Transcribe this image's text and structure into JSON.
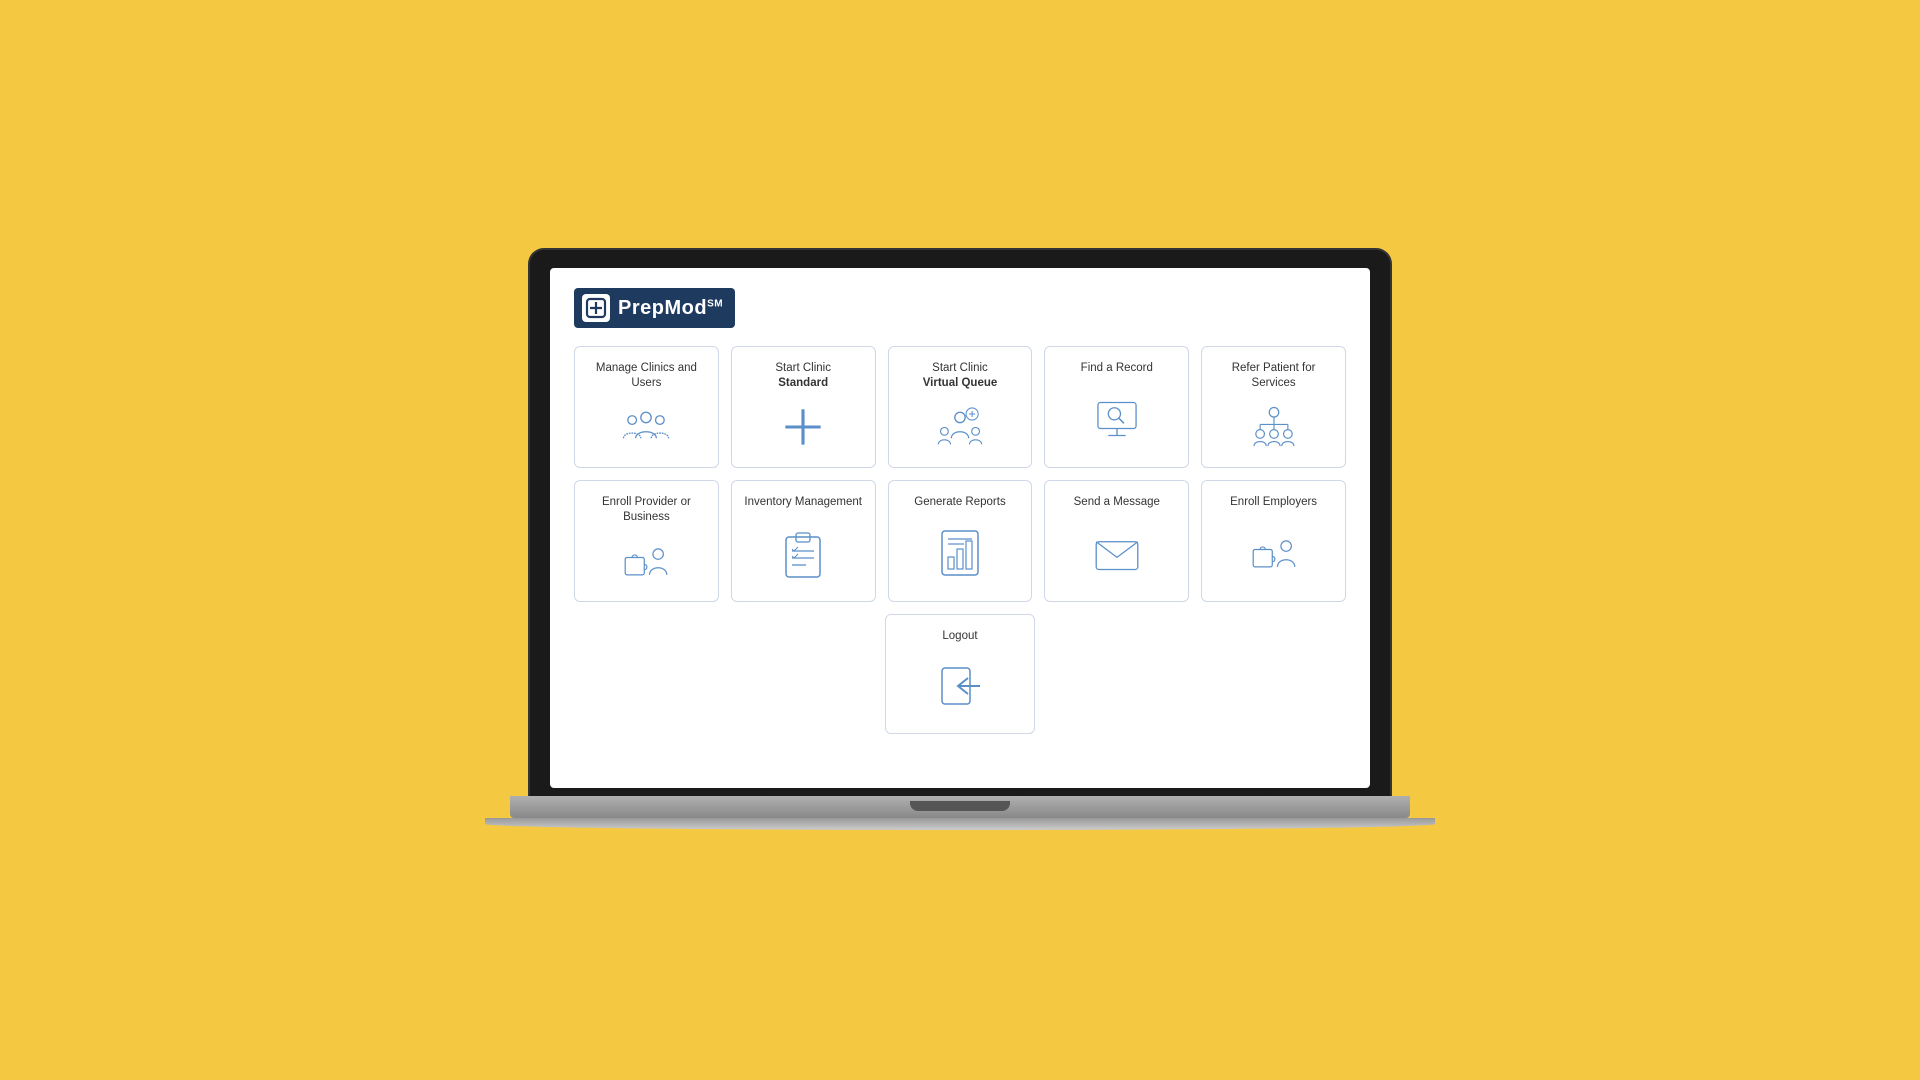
{
  "logo": {
    "brand": "PrepMod",
    "sm_text": "SM",
    "icon_symbol": "✚"
  },
  "cards": [
    {
      "id": "manage-clinics",
      "title": "Manage Clinics and Users",
      "title_bold": null,
      "icon": "manage-clinics-icon"
    },
    {
      "id": "start-clinic-standard",
      "title_plain": "Start Clinic",
      "title_bold": "Standard",
      "icon": "start-clinic-standard-icon"
    },
    {
      "id": "start-clinic-virtual",
      "title_plain": "Start Clinic",
      "title_bold": "Virtual Queue",
      "icon": "start-clinic-virtual-icon"
    },
    {
      "id": "find-record",
      "title": "Find a Record",
      "title_bold": null,
      "icon": "find-record-icon"
    },
    {
      "id": "refer-patient",
      "title": "Refer Patient for Services",
      "title_bold": null,
      "icon": "refer-patient-icon"
    },
    {
      "id": "enroll-provider",
      "title": "Enroll Provider or Business",
      "title_bold": null,
      "icon": "enroll-provider-icon"
    },
    {
      "id": "inventory",
      "title": "Inventory Management",
      "title_bold": null,
      "icon": "inventory-icon"
    },
    {
      "id": "generate-reports",
      "title": "Generate Reports",
      "title_bold": null,
      "icon": "generate-reports-icon"
    },
    {
      "id": "send-message",
      "title": "Send a Message",
      "title_bold": null,
      "icon": "send-message-icon"
    },
    {
      "id": "enroll-employers",
      "title": "Enroll Employers",
      "title_bold": null,
      "icon": "enroll-employers-icon"
    }
  ],
  "logout": {
    "label": "Logout",
    "icon": "logout-icon"
  }
}
